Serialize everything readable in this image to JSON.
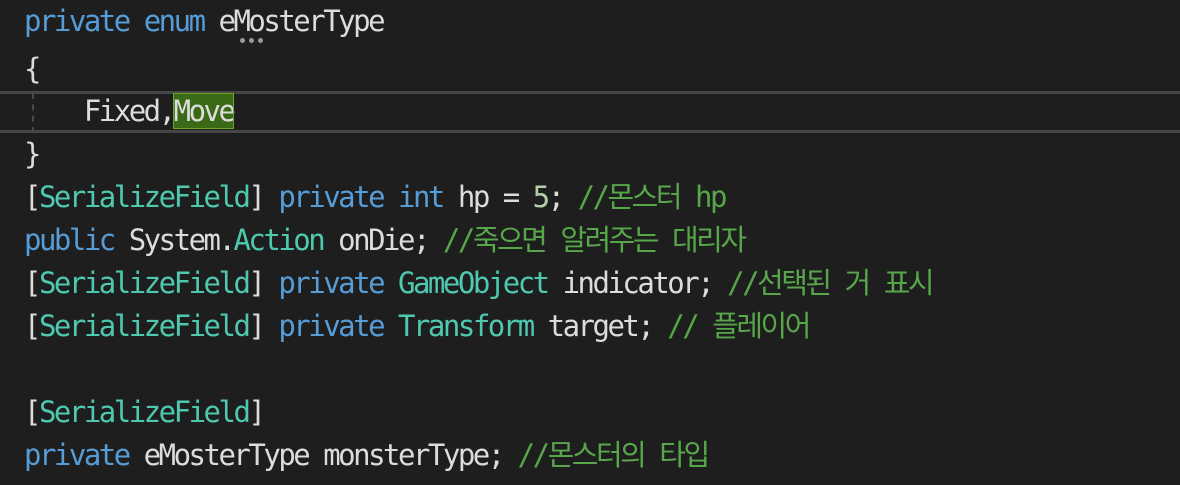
{
  "editor": {
    "lines": [
      {
        "id": "l1",
        "tokens": [
          [
            "kw",
            "private"
          ],
          [
            "pl",
            " "
          ],
          [
            "kw",
            "enum"
          ],
          [
            "pl",
            " "
          ],
          [
            "pl",
            "eMosterType"
          ]
        ]
      },
      {
        "id": "l2",
        "tokens": [
          [
            "pl",
            "{"
          ]
        ]
      },
      {
        "id": "l3",
        "tokens": [
          [
            "pl",
            "    Fixed,"
          ],
          [
            "sel",
            "Move"
          ]
        ]
      },
      {
        "id": "l4",
        "tokens": [
          [
            "pl",
            "}"
          ]
        ]
      },
      {
        "id": "l5",
        "tokens": [
          [
            "pl",
            "["
          ],
          [
            "typ",
            "SerializeField"
          ],
          [
            "pl",
            "] "
          ],
          [
            "kw",
            "private"
          ],
          [
            "pl",
            " "
          ],
          [
            "kw",
            "int"
          ],
          [
            "pl",
            " hp = "
          ],
          [
            "num",
            "5"
          ],
          [
            "pl",
            "; "
          ],
          [
            "cm",
            "//몬스터 hp"
          ]
        ]
      },
      {
        "id": "l6",
        "tokens": [
          [
            "kw",
            "public"
          ],
          [
            "pl",
            " System."
          ],
          [
            "typ",
            "Action"
          ],
          [
            "pl",
            " onDie; "
          ],
          [
            "cm",
            "//죽으면 알려주는 대리자"
          ]
        ]
      },
      {
        "id": "l7",
        "tokens": [
          [
            "pl",
            "["
          ],
          [
            "typ",
            "SerializeField"
          ],
          [
            "pl",
            "] "
          ],
          [
            "kw",
            "private"
          ],
          [
            "pl",
            " "
          ],
          [
            "typ",
            "GameObject"
          ],
          [
            "pl",
            " indicator; "
          ],
          [
            "cm",
            "//선택된 거 표시"
          ]
        ]
      },
      {
        "id": "l8",
        "tokens": [
          [
            "pl",
            "["
          ],
          [
            "typ",
            "SerializeField"
          ],
          [
            "pl",
            "] "
          ],
          [
            "kw",
            "private"
          ],
          [
            "pl",
            " "
          ],
          [
            "typ",
            "Transform"
          ],
          [
            "pl",
            " target; "
          ],
          [
            "cm",
            "// 플레이어"
          ]
        ]
      },
      {
        "id": "l9",
        "tokens": []
      },
      {
        "id": "l10",
        "tokens": [
          [
            "pl",
            "["
          ],
          [
            "typ",
            "SerializeField"
          ],
          [
            "pl",
            "]"
          ]
        ]
      },
      {
        "id": "l11",
        "tokens": [
          [
            "kw",
            "private"
          ],
          [
            "pl",
            " eMosterType monsterType; "
          ],
          [
            "cm",
            "//몬스터의 타입"
          ]
        ]
      }
    ]
  },
  "colors": {
    "background": "#1e1e1e",
    "keyword": "#569cd6",
    "type": "#4ec9b0",
    "comment": "#57a64a",
    "plain": "#dcdcdc",
    "selection": "#3a6a16"
  }
}
